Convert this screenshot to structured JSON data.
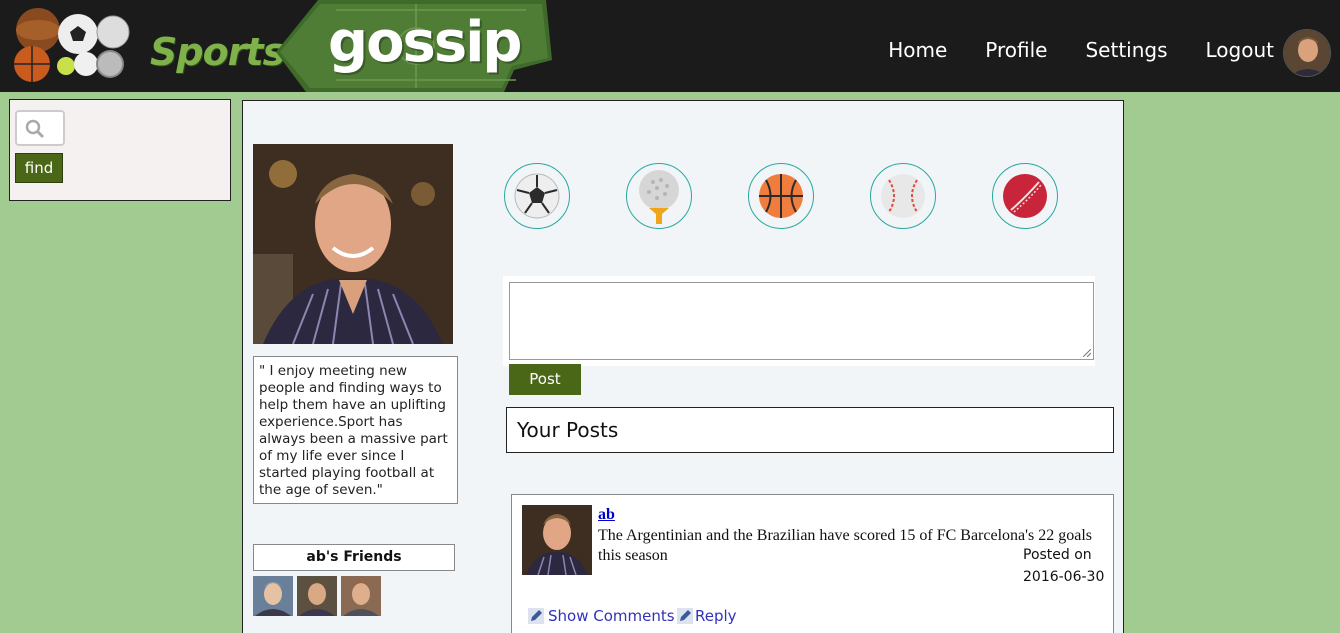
{
  "header": {
    "logo_sports": "Sports",
    "logo_gossip": "gossip",
    "nav": [
      "Home",
      "Profile",
      "Settings",
      "Logout"
    ]
  },
  "search": {
    "find_label": "find"
  },
  "profile": {
    "bio": "\" I enjoy meeting new people and finding ways to help them have an uplifting experience.Sport has always been a massive part of my life ever since I started playing football at the age of seven.\"",
    "friends_title": "ab's Friends"
  },
  "sports": [
    "soccer-ball",
    "golf-ball",
    "basketball",
    "baseball",
    "cricket-ball"
  ],
  "composer": {
    "post_label": "Post"
  },
  "posts_section": {
    "title": "Your Posts"
  },
  "post": {
    "author": "ab",
    "text": "The Argentinian and the Brazilian have scored 15 of FC Barcelona's 22 goals this season",
    "posted_label": "Posted on",
    "posted_date": "2016-06-30",
    "show_comments_label": "Show Comments",
    "reply_label": "Reply"
  }
}
